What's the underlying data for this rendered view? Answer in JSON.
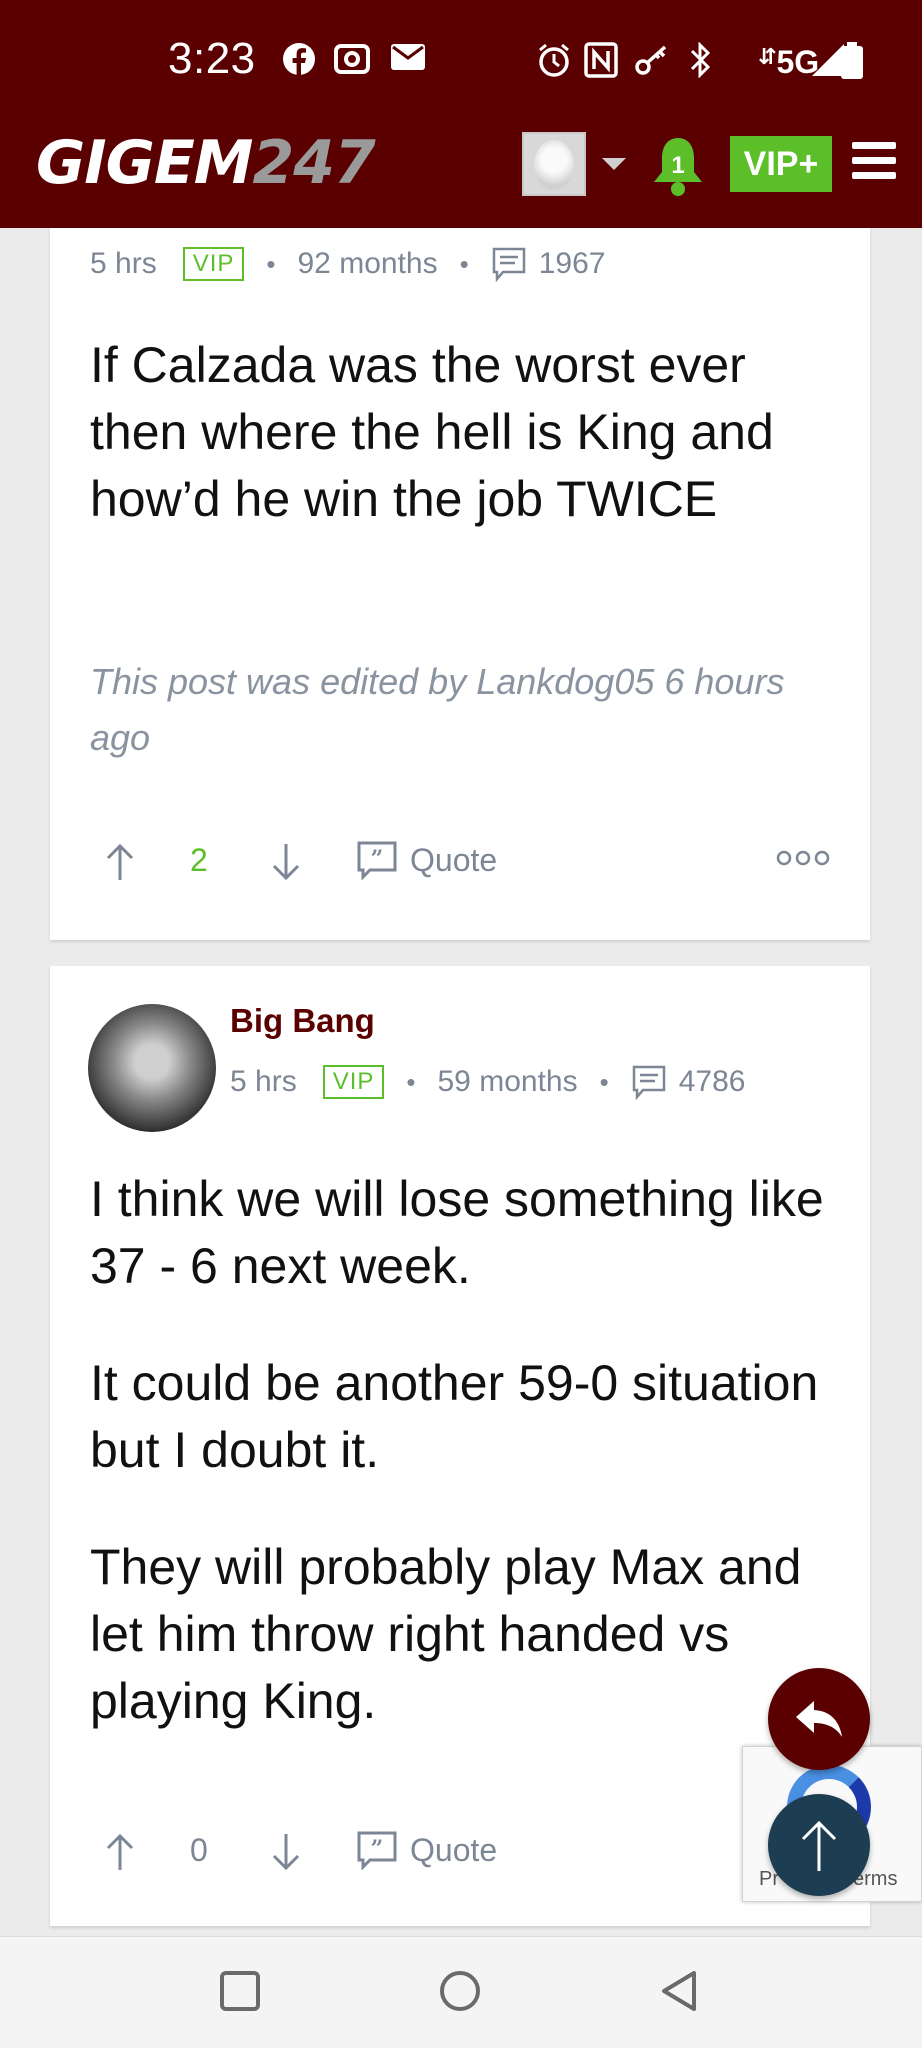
{
  "status_bar": {
    "time": "3:23",
    "network": "5G",
    "icons": [
      "facebook-icon",
      "camera-icon",
      "mail-icon",
      "alarm-icon",
      "nfc-icon",
      "key-icon",
      "bluetooth-icon",
      "signal-icon",
      "battery-icon"
    ]
  },
  "header": {
    "logo_text": "GIGEM",
    "logo_number": "247",
    "notification_count": "1",
    "vip_label": "VIP+",
    "colors": {
      "brand": "#5a0000",
      "accent": "#5cbf2a",
      "logo_number": "#9a9a9a"
    }
  },
  "posts": [
    {
      "age": "5 hrs",
      "badge": "VIP",
      "membership": "92 months",
      "post_count": "1967",
      "body": [
        "If Calzada was the worst ever then where the hell is King and how’d he win the job TWICE"
      ],
      "edited_note": "This post was edited by Lankdog05 6 hours ago",
      "votes": "2",
      "quote_label": "Quote"
    },
    {
      "author": "Big Bang",
      "age": "5 hrs",
      "badge": "VIP",
      "membership": "59 months",
      "post_count": "4786",
      "body": [
        "I think we will lose something like 37 - 6 next week.",
        "It could be another 59-0 situation but I doubt it.",
        "They will probably play Max and let him throw right handed vs playing King."
      ],
      "votes": "0",
      "quote_label": "Quote"
    }
  ],
  "recaptcha": {
    "text_left": "Pr",
    "text_right": "erms"
  }
}
